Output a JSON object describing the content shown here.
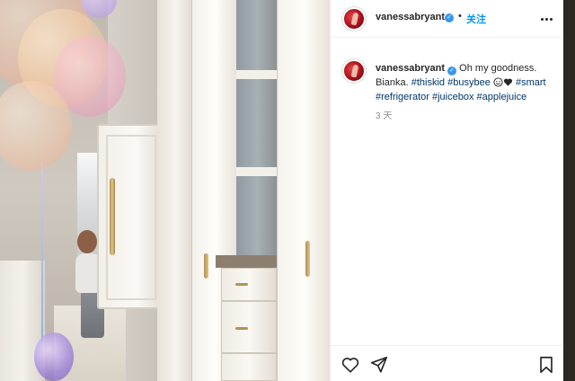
{
  "post": {
    "username": "vanessabryant",
    "verified_mark": "✓",
    "separator": "•",
    "follow_label": "关注",
    "more_icon": "more-horizontal-icon",
    "caption": {
      "username": "vanessabryant",
      "verified_mark": "✓",
      "text_start": "Oh my goodness. Bianka. ",
      "tags": [
        "#thiskid",
        "#busybee",
        "#smart",
        "#refrigerator",
        "#juicebox",
        "#applejuice"
      ],
      "emojis": [
        "smiling-face-icon",
        "black-heart-icon"
      ]
    },
    "time_ago": "3 天"
  },
  "actions": {
    "like_icon": "heart-icon",
    "share_icon": "send-icon",
    "save_icon": "bookmark-icon"
  },
  "photo": {
    "description_icon": "photo"
  },
  "colors": {
    "link_blue": "#0095f6",
    "hashtag": "#00376b",
    "verified": "#3897f0",
    "text": "#262626",
    "muted": "#8e8e8e"
  }
}
